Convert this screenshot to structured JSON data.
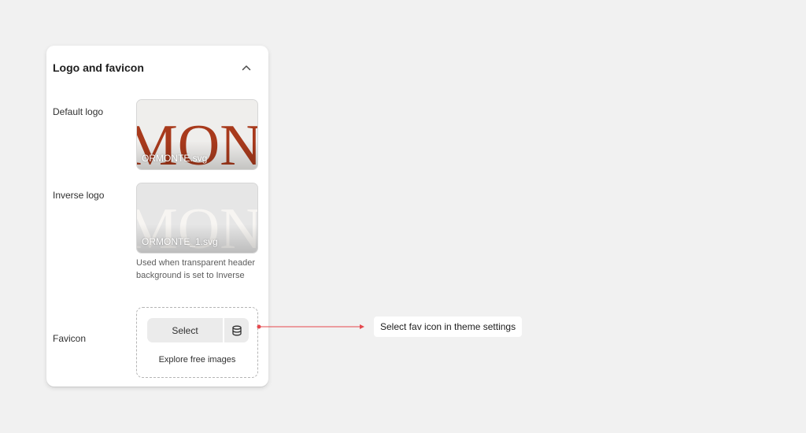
{
  "panel": {
    "title": "Logo and favicon"
  },
  "default_logo": {
    "label": "Default logo",
    "file_name": "ORMONTE.svg",
    "logo_text": "MON",
    "logo_color": "#a83a1c"
  },
  "inverse_logo": {
    "label": "Inverse logo",
    "file_name": "ORMONTE_1.svg",
    "logo_text": "MON",
    "logo_color": "#f7f5f2",
    "help_text": "Used when transparent header background is set to Inverse"
  },
  "favicon": {
    "label": "Favicon",
    "select_label": "Select",
    "explore_label": "Explore free images"
  },
  "callout": {
    "text": "Select fav icon in theme settings",
    "line_color": "#e5484d"
  }
}
